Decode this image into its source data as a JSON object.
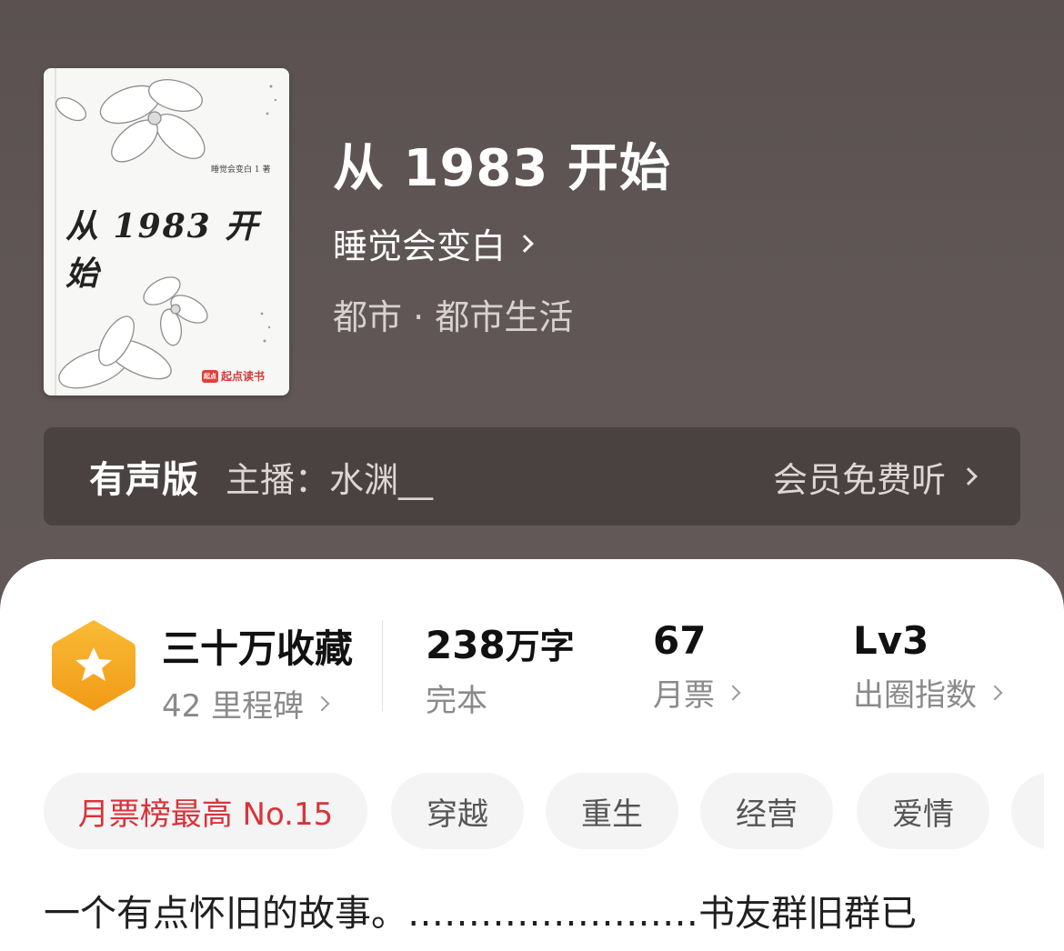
{
  "cover": {
    "title": "从 1983 开 始",
    "author": "睡觉会变白 1 著",
    "brand": "起点读书",
    "brand_logo": "起点"
  },
  "book": {
    "title": "从 1983 开始",
    "author": "睡觉会变白",
    "genre": "都市 · 都市生活"
  },
  "audio": {
    "label": "有声版",
    "host": "主播：水渊__",
    "action": "会员免费听"
  },
  "stats": {
    "collection": {
      "main": "三十万收藏",
      "sub": "42 里程碑"
    },
    "words": {
      "number": "238",
      "unit": "万字",
      "sub": "完本"
    },
    "tickets": {
      "main": "67",
      "sub": "月票"
    },
    "index": {
      "main": "Lv3",
      "sub": "出圈指数"
    }
  },
  "tags": [
    "月票榜最高 No.15",
    "穿越",
    "重生",
    "经营",
    "爱情"
  ],
  "synopsis": "一个有点怀旧的故事。……………………书友群旧群已",
  "colors": {
    "header_bg": "#5f5655",
    "audio_bar_bg": "#4a4241",
    "badge_orange": "#f5a623",
    "rank_tag_red": "#d9333a"
  }
}
